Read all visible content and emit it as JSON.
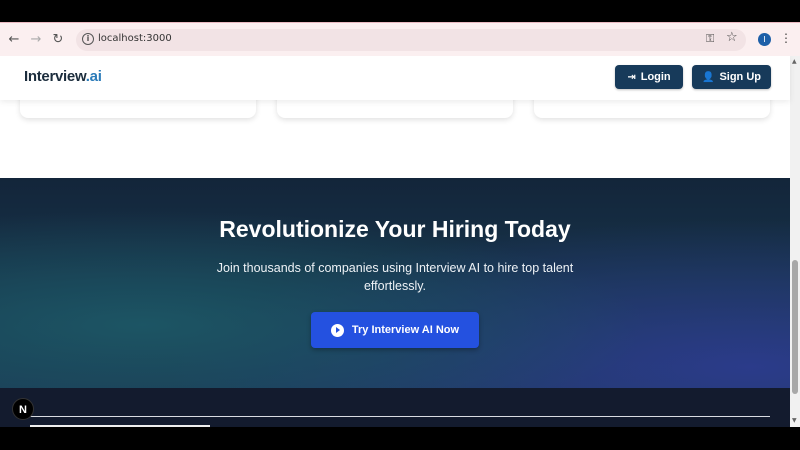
{
  "browser": {
    "url": "localhost:3000",
    "back_icon": "arrow-left-icon",
    "forward_icon": "arrow-right-icon",
    "reload_icon": "reload-icon",
    "profile_initial": "I"
  },
  "header": {
    "logo_main": "Interview",
    "logo_suffix": ".ai",
    "login_label": "Login",
    "signup_label": "Sign Up",
    "accent": "#173a5a"
  },
  "hero": {
    "title": "Revolutionize Your Hiring Today",
    "subtitle": "Join thousands of companies using Interview AI to hire top talent effortlessly.",
    "cta_label": "Try Interview AI Now",
    "cta_color": "#2451e0"
  },
  "badge": {
    "label": "N"
  }
}
